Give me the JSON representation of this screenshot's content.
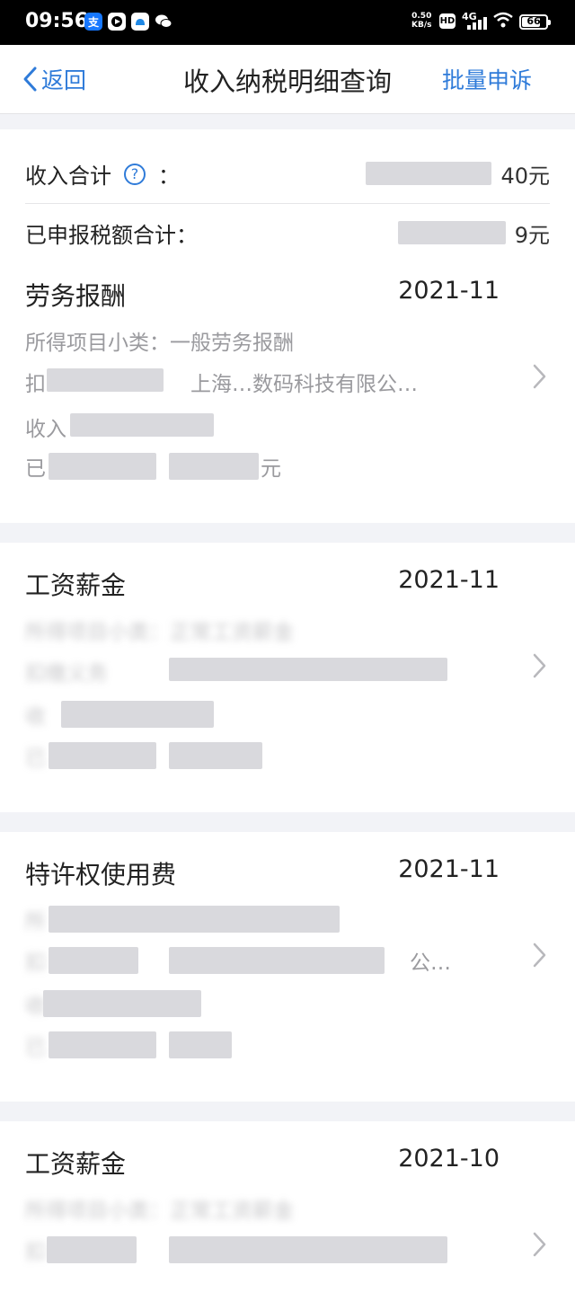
{
  "status_bar": {
    "time": "09:56",
    "net_speed_value": "0.50",
    "net_speed_unit": "KB/s",
    "hd_label": "HD",
    "network": "4G",
    "battery": "66"
  },
  "nav": {
    "back_label": "返回",
    "title": "收入纳税明细查询",
    "action_label": "批量申诉"
  },
  "summary": {
    "income_label": "收入合计",
    "income_colon": "：",
    "income_value_suffix": "40元",
    "tax_label": "已申报税额合计：",
    "tax_value_suffix": "9元"
  },
  "records": [
    {
      "type": "劳务报酬",
      "date": "2021-11",
      "subcategory": "所得项目小类：一般劳务报酬",
      "withholder_prefix": "扣",
      "withholder_partial": "上海…数码科技有限公…",
      "income_prefix": "收入",
      "tax_prefix": "已",
      "tax_suffix": "元"
    },
    {
      "type": "工资薪金",
      "date": "2021-11",
      "subcategory_partial": "所得项目小类：正常工资薪金",
      "withholder_prefix": "扣缴义务",
      "income_prefix": "收",
      "tax_prefix": "已"
    },
    {
      "type": "特许权使用费",
      "date": "2021-11",
      "subcategory_partial": "所",
      "withholder_prefix": "扣",
      "withholder_partial": "公…",
      "income_prefix": "收",
      "tax_prefix": "已"
    },
    {
      "type": "工资薪金",
      "date": "2021-10",
      "subcategory_partial": "所得项目小类：正常工资薪金",
      "withholder_prefix": "扣",
      "income_prefix": "",
      "tax_prefix": ""
    }
  ],
  "colors": {
    "accent": "#2f7bd9",
    "background": "#f2f3f7",
    "muted_text": "#9a9a9e"
  }
}
